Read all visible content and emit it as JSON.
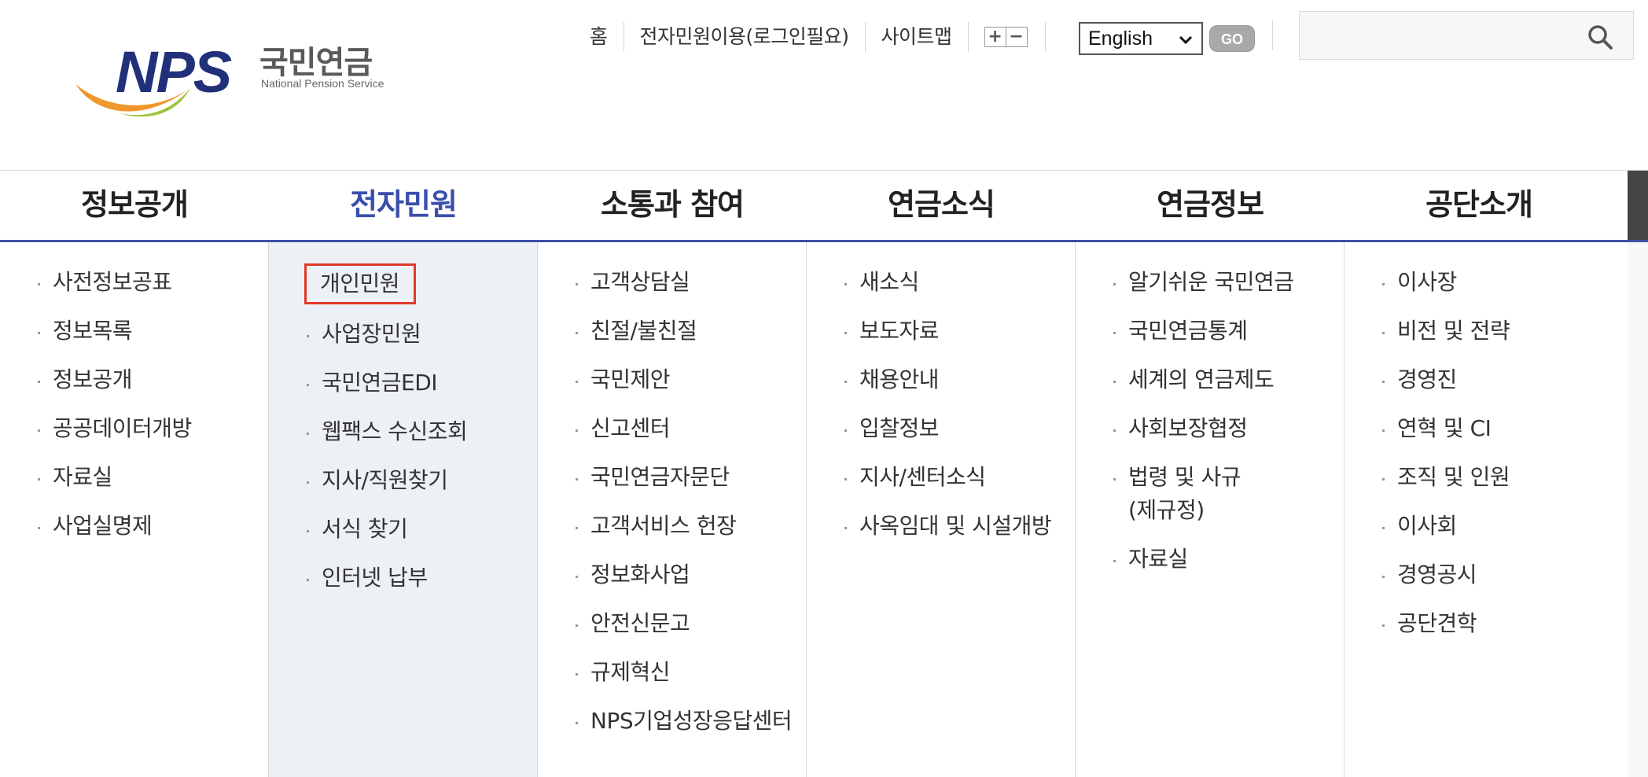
{
  "logo": {
    "brand": "NPS",
    "korean": "국민연금",
    "english": "National Pension Service"
  },
  "util": {
    "links": [
      "홈",
      "전자민원이용(로그인필요)",
      "사이트맵"
    ],
    "font_plus": "+",
    "font_minus": "−",
    "language": "English",
    "go": "GO",
    "search_placeholder": ""
  },
  "gnb": [
    {
      "label": "정보공개"
    },
    {
      "label": "전자민원",
      "active": true
    },
    {
      "label": "소통과 참여"
    },
    {
      "label": "연금소식"
    },
    {
      "label": "연금정보"
    },
    {
      "label": "공단소개"
    }
  ],
  "menu": [
    [
      "사전정보공표",
      "정보목록",
      "정보공개",
      "공공데이터개방",
      "자료실",
      "사업실명제"
    ],
    [
      "개인민원",
      "사업장민원",
      "국민연금EDI",
      "웹팩스 수신조회",
      "지사/직원찾기",
      "서식 찾기",
      "인터넷 납부"
    ],
    [
      "고객상담실",
      "친절/불친절",
      "국민제안",
      "신고센터",
      "국민연금자문단",
      "고객서비스 헌장",
      "정보화사업",
      "안전신문고",
      "규제혁신",
      "NPS기업성장응답센터"
    ],
    [
      "새소식",
      "보도자료",
      "채용안내",
      "입찰정보",
      "지사/센터소식",
      "사옥임대 및 시설개방"
    ],
    [
      "알기쉬운 국민연금",
      "국민연금통계",
      "세계의 연금제도",
      "사회보장협정",
      "법령 및 사규(제규정)",
      "자료실"
    ],
    [
      "이사장",
      "비전 및 전략",
      "경영진",
      "연혁 및 CI",
      "조직 및 인원",
      "이사회",
      "경영공시",
      "공단견학"
    ]
  ],
  "colors": {
    "accent": "#3a4fab",
    "highlight_box": "#e0392b",
    "active_column_bg": "#edf0f5"
  }
}
